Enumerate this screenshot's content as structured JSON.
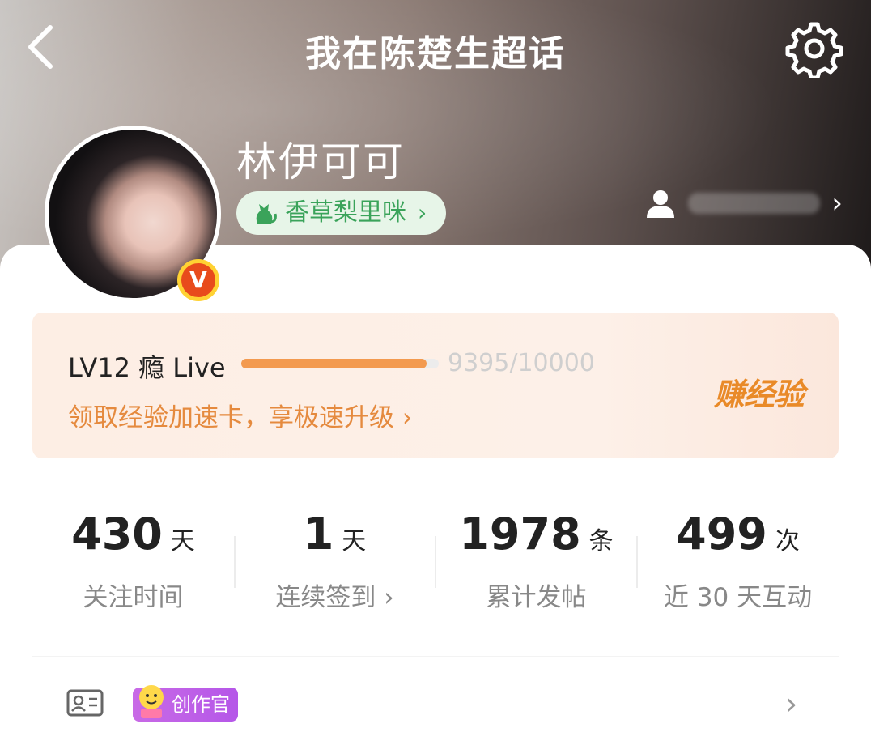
{
  "header": {
    "title": "我在陈楚生超话",
    "back_icon": "chevron-left-icon",
    "settings_icon": "gear-icon"
  },
  "profile": {
    "username": "林伊可可",
    "fan_tag": {
      "label": "香草梨里咪",
      "chevron": "›",
      "icon": "cat-icon"
    },
    "verified_badge": "V",
    "profile_link_chevron": "›"
  },
  "level": {
    "label": "LV12 瘾 Live",
    "progress_text": "9395/10000",
    "progress_fraction": 0.9395,
    "boost_link": "领取经验加速卡，享极速升级 ›",
    "earn_button": "赚经验",
    "accent_color": "#f39a4f"
  },
  "stats": [
    {
      "num": "430",
      "unit": "天",
      "label": "关注时间"
    },
    {
      "num": "1",
      "unit": "天",
      "label": "连续签到 ›"
    },
    {
      "num": "1978",
      "unit": "条",
      "label": "累计发帖"
    },
    {
      "num": "499",
      "unit": "次",
      "label": "近 30 天互动"
    }
  ],
  "creator": {
    "badge_label": "创作官",
    "icon": "id-card-icon",
    "chevron": "›"
  }
}
